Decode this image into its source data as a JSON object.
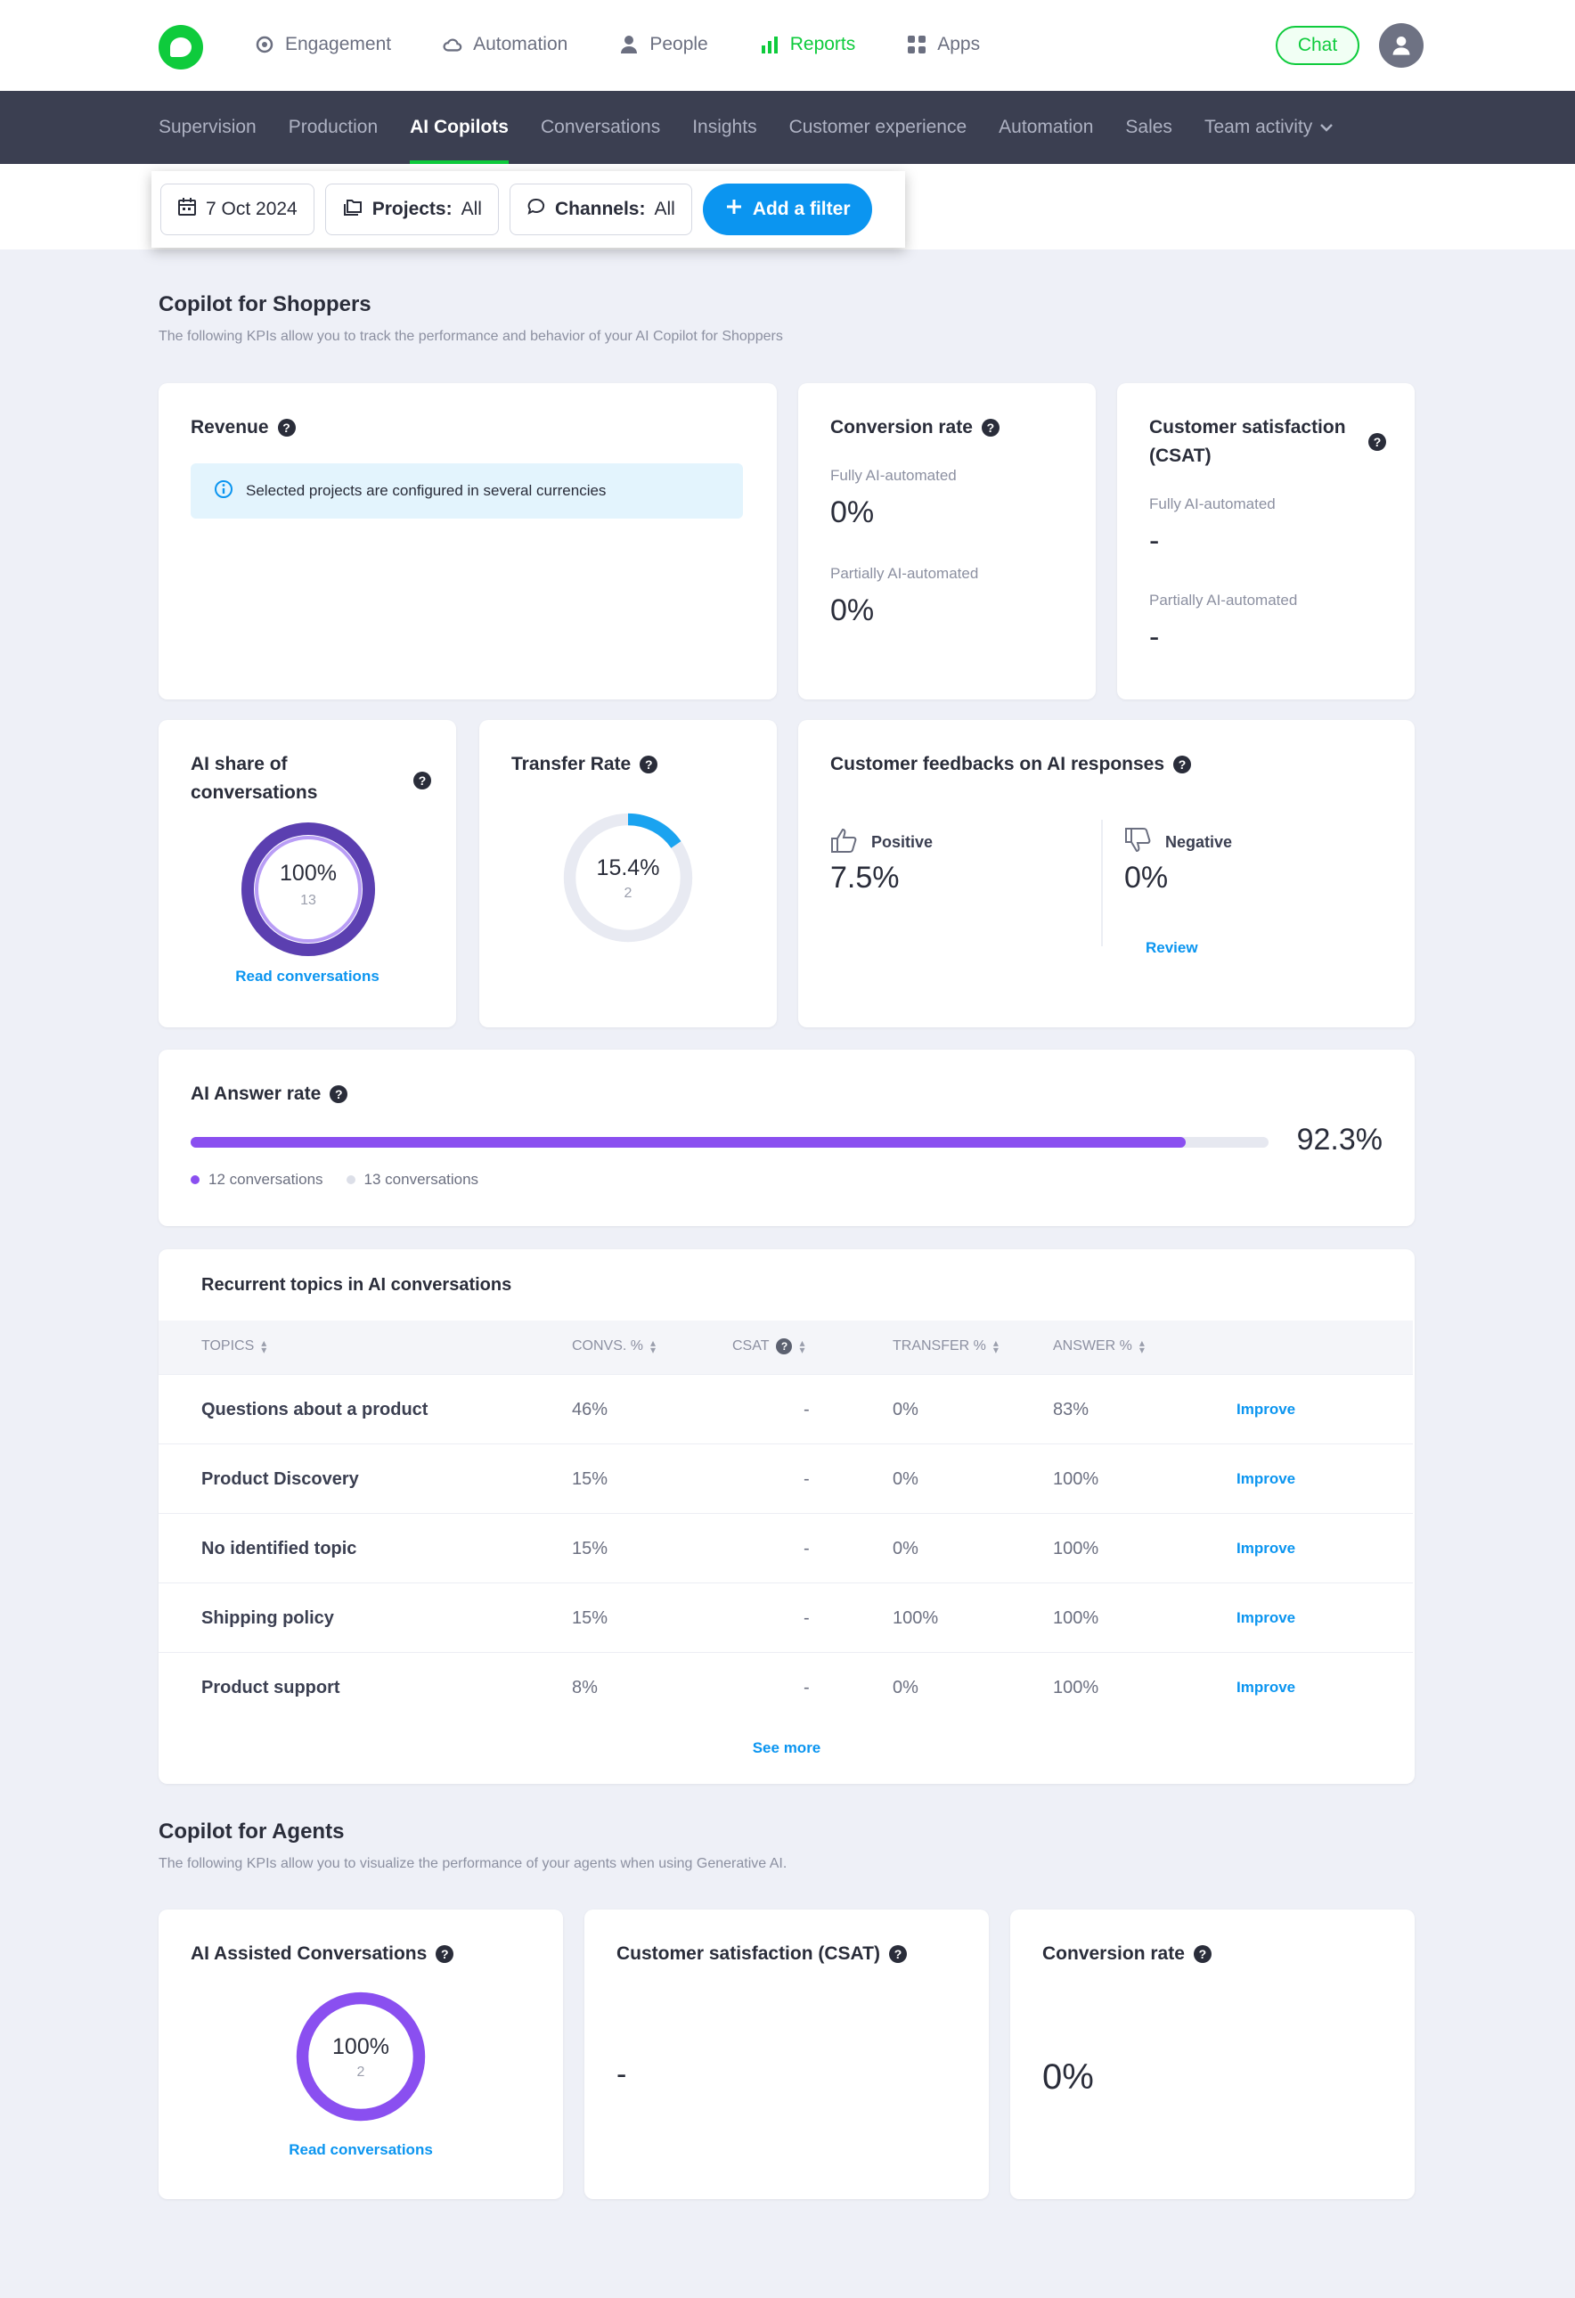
{
  "nav": {
    "items": [
      {
        "label": "Engagement",
        "icon": "target-icon",
        "active": false
      },
      {
        "label": "Automation",
        "icon": "cloud-icon",
        "active": false
      },
      {
        "label": "People",
        "icon": "person-icon",
        "active": false
      },
      {
        "label": "Reports",
        "icon": "bar-chart-icon",
        "active": true
      },
      {
        "label": "Apps",
        "icon": "grid-icon",
        "active": false
      }
    ],
    "chat_label": "Chat"
  },
  "subnav": {
    "items": [
      "Supervision",
      "Production",
      "AI Copilots",
      "Conversations",
      "Insights",
      "Customer experience",
      "Automation",
      "Sales",
      "Team activity"
    ],
    "active_index": 2
  },
  "filters": {
    "date": "7 Oct 2024",
    "projects_label": "Projects:",
    "projects_value": "All",
    "channels_label": "Channels:",
    "channels_value": "All",
    "add_filter": "Add a filter"
  },
  "shoppers": {
    "title": "Copilot for Shoppers",
    "subtitle": "The following KPIs allow you to track the performance and behavior of your AI Copilot for Shoppers",
    "revenue": {
      "title": "Revenue",
      "info": "Selected projects are configured in several currencies"
    },
    "conversion": {
      "title": "Conversion rate",
      "fully_label": "Fully AI-automated",
      "fully_value": "0%",
      "partial_label": "Partially AI-automated",
      "partial_value": "0%"
    },
    "csat": {
      "title_line1": "Customer satisfaction",
      "title_line2": "(CSAT)",
      "fully_label": "Fully AI-automated",
      "fully_value": "-",
      "partial_label": "Partially AI-automated",
      "partial_value": "-"
    },
    "ai_share": {
      "title_line1": "AI share of",
      "title_line2": "conversations",
      "value": "100%",
      "count": "13",
      "fraction": 1.0,
      "link": "Read conversations"
    },
    "transfer": {
      "title": "Transfer Rate",
      "value": "15.4%",
      "count": "2",
      "fraction": 0.154
    },
    "feedback": {
      "title": "Customer feedbacks on AI responses",
      "positive_label": "Positive",
      "positive_value": "7.5%",
      "negative_label": "Negative",
      "negative_value": "0%",
      "review": "Review"
    },
    "answer_rate": {
      "title": "AI Answer rate",
      "value": "92.3%",
      "fraction": 0.923,
      "legend_answered": "12 conversations",
      "legend_total": "13 conversations"
    },
    "topics": {
      "title": "Recurrent topics in AI conversations",
      "headers": [
        "Topics",
        "Convs. %",
        "CSAT",
        "Transfer %",
        "Answer %"
      ],
      "rows": [
        {
          "topic": "Questions about a product",
          "convs": "46%",
          "csat": "-",
          "transfer": "0%",
          "answer": "83%",
          "action": "Improve"
        },
        {
          "topic": "Product Discovery",
          "convs": "15%",
          "csat": "-",
          "transfer": "0%",
          "answer": "100%",
          "action": "Improve"
        },
        {
          "topic": "No identified topic",
          "convs": "15%",
          "csat": "-",
          "transfer": "0%",
          "answer": "100%",
          "action": "Improve"
        },
        {
          "topic": "Shipping policy",
          "convs": "15%",
          "csat": "-",
          "transfer": "100%",
          "answer": "100%",
          "action": "Improve"
        },
        {
          "topic": "Product support",
          "convs": "8%",
          "csat": "-",
          "transfer": "0%",
          "answer": "100%",
          "action": "Improve"
        }
      ],
      "see_more": "See more"
    }
  },
  "agents": {
    "title": "Copilot for Agents",
    "subtitle": "The following KPIs allow you to visualize the performance of your agents when using Generative AI.",
    "assisted": {
      "title": "AI Assisted Conversations",
      "value": "100%",
      "count": "2",
      "fraction": 1.0,
      "link": "Read conversations"
    },
    "csat": {
      "title": "Customer satisfaction (CSAT)",
      "value": "-"
    },
    "conversion": {
      "title": "Conversion rate",
      "value": "0%"
    }
  },
  "colors": {
    "brand_green": "#0ecb3c",
    "accent_blue": "#0b95f0",
    "purple_dark": "#5b3fb0",
    "purple_mid": "#8a5cf0",
    "subnav_bg": "#3b3f51"
  }
}
